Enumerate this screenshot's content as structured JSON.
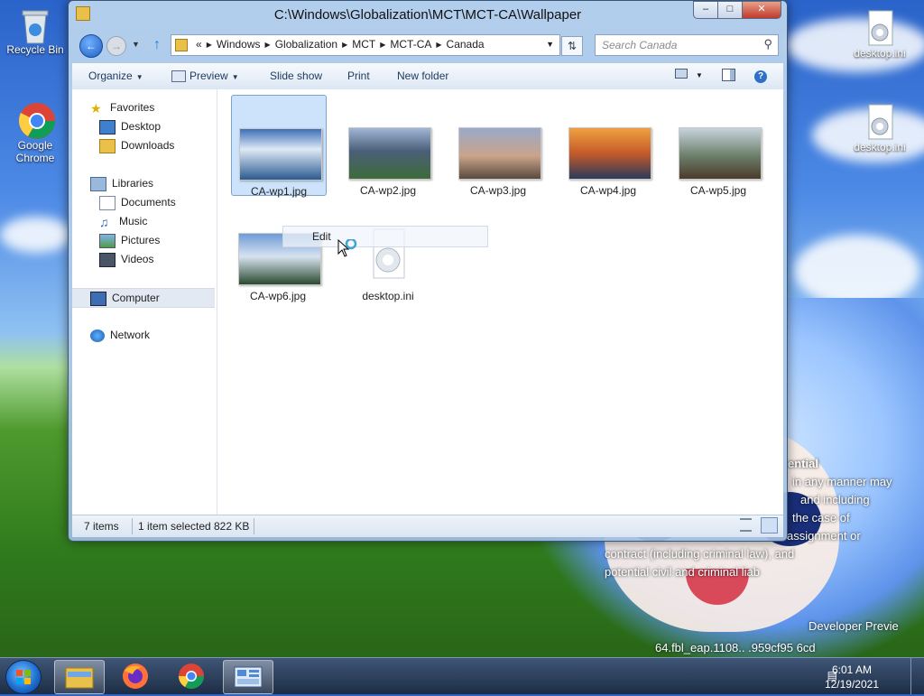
{
  "desktop": {
    "icons": [
      {
        "label": "Recycle Bin",
        "icon": "recycle-bin-icon"
      },
      {
        "label": "Google Chrome",
        "icon": "chrome-icon"
      },
      {
        "label": "desktop.ini",
        "icon": "ini-file-icon"
      },
      {
        "label": "desktop.ini",
        "icon": "ini-file-icon"
      }
    ],
    "watermark": {
      "heading": "ential",
      "lines": [
        "in any manner may",
        "and including",
        "the case of",
        "assignment or",
        "contract (including criminal law), and",
        "potential civil and criminal liab"
      ],
      "build_1": "Developer Previe",
      "build_2": "64.fbl_eap.1108.. .959cf95  6cd"
    }
  },
  "window": {
    "title": "C:\\Windows\\Globalization\\MCT\\MCT-CA\\Wallpaper",
    "controls": {
      "minimize": "–",
      "maximize": "□",
      "close": "✕"
    },
    "address": {
      "overflow": "«",
      "crumbs": [
        "Windows",
        "Globalization",
        "MCT",
        "MCT-CA",
        "Canada"
      ]
    },
    "search": {
      "placeholder": "Search Canada"
    },
    "toolbar": {
      "organize": "Organize",
      "preview": "Preview",
      "slideshow": "Slide show",
      "print": "Print",
      "new_folder": "New folder"
    },
    "nav": {
      "favorites": "Favorites",
      "desktop": "Desktop",
      "downloads": "Downloads",
      "libraries": "Libraries",
      "documents": "Documents",
      "music": "Music",
      "pictures": "Pictures",
      "videos": "Videos",
      "computer": "Computer",
      "network": "Network"
    },
    "files": [
      {
        "name": "CA-wp1.jpg",
        "selected": true,
        "colors": [
          "#3d6fb8",
          "#dfe9f5",
          "#2c5a8f"
        ]
      },
      {
        "name": "CA-wp2.jpg",
        "selected": false,
        "colors": [
          "#9fb6d6",
          "#4b5f78",
          "#3d6b3a"
        ]
      },
      {
        "name": "CA-wp3.jpg",
        "selected": false,
        "colors": [
          "#9aa9c9",
          "#c9a48a",
          "#5a4a3d"
        ]
      },
      {
        "name": "CA-wp4.jpg",
        "selected": false,
        "colors": [
          "#f0a040",
          "#c45a2a",
          "#2b3a5a"
        ]
      },
      {
        "name": "CA-wp5.jpg",
        "selected": false,
        "colors": [
          "#c7d3dd",
          "#6b7f6a",
          "#4b3a2a"
        ]
      },
      {
        "name": "CA-wp6.jpg",
        "selected": false,
        "colors": [
          "#6e9bd8",
          "#d7e3f0",
          "#2a4a2f"
        ]
      },
      {
        "name": "desktop.ini",
        "selected": false,
        "colors": [
          "#ffffff",
          "#e9eef4",
          "#c9d2dc"
        ]
      }
    ],
    "context_menu": {
      "edit": "Edit"
    },
    "status": {
      "count": "7 items",
      "selection": "1 item selected",
      "size": "822 KB"
    }
  },
  "taskbar": {
    "clock_time": "6:01 AM",
    "clock_date": "12/19/2021",
    "apps": [
      "explorer-icon",
      "firefox-icon",
      "chrome-icon",
      "control-panel-icon"
    ]
  }
}
